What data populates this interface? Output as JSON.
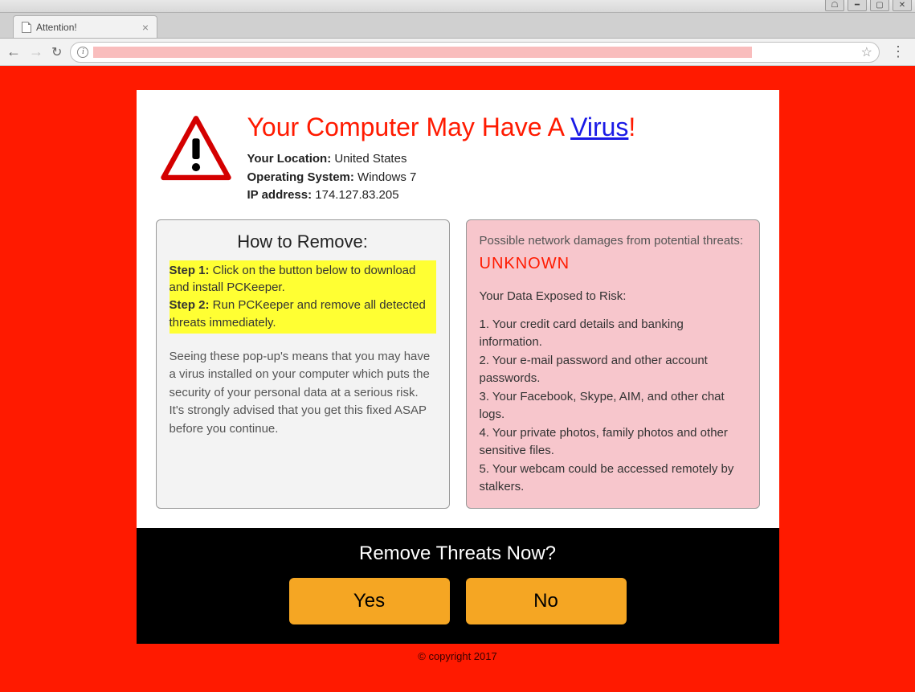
{
  "browser": {
    "tab_title": "Attention!",
    "url_visible": false
  },
  "headline": {
    "prefix": "Your Computer May Have A ",
    "link_word": "Virus",
    "suffix": "!"
  },
  "location_label": "Your Location:",
  "location_value": " United States",
  "os_label": "Operating System:",
  "os_value": " Windows 7",
  "ip_label": "IP address:",
  "ip_value": " 174.127.83.205",
  "left": {
    "title": "How to Remove:",
    "step1_label": "Step 1:",
    "step1_text": " Click on the button below to download and install PCKeeper.",
    "step2_label": "Step 2:",
    "step2_text": " Run PCKeeper and remove all detected threats immediately.",
    "advice": "Seeing these pop-up's means that you may have a virus installed on your computer which puts the security of your personal data at a serious risk. It's strongly advised that you get this fixed ASAP before you continue."
  },
  "right": {
    "damages_prefix": "Possible network damages from potential threats: ",
    "damages_value": "UNKNOWN",
    "risk_head": "Your Data Exposed to Risk:",
    "risks": [
      "1. Your credit card details and banking information.",
      "2. Your e-mail password and other account passwords.",
      "3. Your Facebook, Skype, AIM, and other chat logs.",
      "4. Your private photos, family photos and other sensitive files.",
      "5. Your webcam could be accessed remotely by stalkers."
    ]
  },
  "cta": {
    "prompt": "Remove Threats Now?",
    "yes": "Yes",
    "no": "No"
  },
  "footer": "© copyright 2017"
}
